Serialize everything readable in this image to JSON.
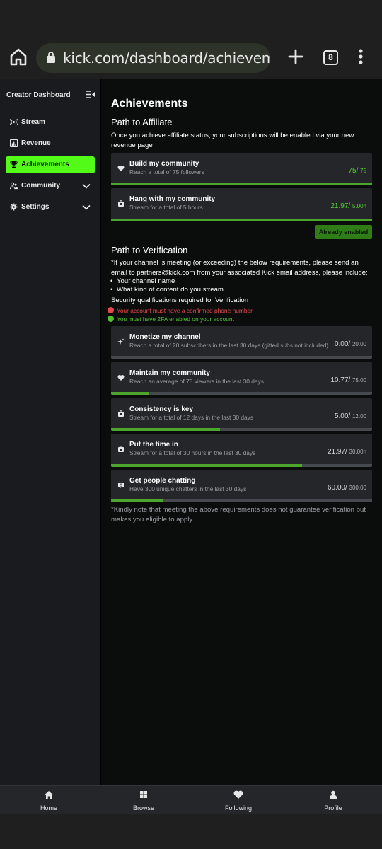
{
  "browser": {
    "url": "kick.com/dashboard/achievements",
    "tab_count": "8"
  },
  "sidebar": {
    "title": "Creator Dashboard",
    "items": [
      {
        "label": "Stream",
        "icon": "broadcast-icon"
      },
      {
        "label": "Revenue",
        "icon": "chart-icon"
      },
      {
        "label": "Achievements",
        "icon": "trophy-icon",
        "active": true
      },
      {
        "label": "Community",
        "icon": "users-icon",
        "expandable": true
      },
      {
        "label": "Settings",
        "icon": "gear-icon",
        "expandable": true
      }
    ],
    "accent": "#53fc18"
  },
  "page": {
    "title": "Achievements",
    "affiliate": {
      "heading": "Path to Affiliate",
      "intro": "Once you achieve affiliate status, your subscriptions will be enabled via your new revenue page",
      "cards": [
        {
          "title": "Build my community",
          "subtitle": "Reach a total of 75 followers",
          "value": "75/",
          "target": "75",
          "progress": 1.0,
          "icon": "heart-icon"
        },
        {
          "title": "Hang with my community",
          "subtitle": "Stream for a total of 5 hours",
          "value": "21.97/",
          "target": "5.00h",
          "progress": 1.0,
          "icon": "video-icon"
        }
      ],
      "status_button": "Already enabled"
    },
    "verification": {
      "heading": "Path to Verification",
      "intro": "*If your channel is meeting (or exceeding) the below requirements, please send an email to partners@kick.com from your associated Kick email address, please include:",
      "bullets": [
        "Your channel name",
        "What kind of content do you stream"
      ],
      "security_heading": "Security qualifications required for Verification",
      "security_items": [
        {
          "text": "Your account must have a confirmed phone number",
          "met": false
        },
        {
          "text": "You must have 2FA enabled on your account",
          "met": true
        }
      ],
      "cards": [
        {
          "title": "Monetize my channel",
          "subtitle": "Reach a total of 20 subscribers in the last 30 days (gifted subs not included)",
          "value": "0.00/",
          "target": "20.00",
          "progress": 0.0,
          "icon": "sparkle-icon"
        },
        {
          "title": "Maintain my community",
          "subtitle": "Reach an average of 75 viewers in the last 30 days",
          "value": "10.77/",
          "target": "75.00",
          "progress": 0.1436,
          "icon": "heart-icon"
        },
        {
          "title": "Consistency is key",
          "subtitle": "Stream for a total of 12 days in the last 30 days",
          "value": "5.00/",
          "target": "12.00",
          "progress": 0.4167,
          "icon": "video-icon"
        },
        {
          "title": "Put the time in",
          "subtitle": "Stream for a total of 30 hours in the last 30 days",
          "value": "21.97/",
          "target": "30.00h",
          "progress": 0.7323,
          "icon": "video-icon"
        },
        {
          "title": "Get people chatting",
          "subtitle": "Have 300 unique chatters in the last 30 days",
          "value": "60.00/",
          "target": "300.00",
          "progress": 0.2,
          "icon": "chat-icon"
        }
      ],
      "footnote": "*Kindly note that meeting the above requirements does not guarantee verification but makes you eligible to apply."
    }
  },
  "bottom_nav": [
    {
      "label": "Home",
      "icon": "home-icon"
    },
    {
      "label": "Browse",
      "icon": "grid-icon"
    },
    {
      "label": "Following",
      "icon": "heart-icon"
    },
    {
      "label": "Profile",
      "icon": "person-icon"
    }
  ]
}
